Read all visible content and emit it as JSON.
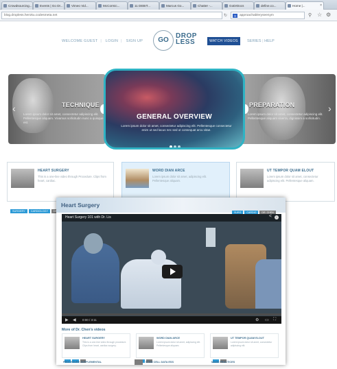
{
  "browser": {
    "tabs": [
      {
        "label": "Crowdsourcing..."
      },
      {
        "label": "Events | Go Dr..."
      },
      {
        "label": "Vimeo Vid..."
      },
      {
        "label": "McCormic..."
      },
      {
        "label": "11 DEBIT..."
      },
      {
        "label": "Marcus Go..."
      },
      {
        "label": "Chatter -..."
      },
      {
        "label": "GoDrDocs"
      },
      {
        "label": "define.co..."
      },
      {
        "label": "Home |..."
      }
    ],
    "url": "blog.dropless.heroku.codesmeta.net",
    "search": "approachableryseenym"
  },
  "header": {
    "nav_left": [
      "WELCOME GUEST",
      "LOGIN",
      "SIGN UP"
    ],
    "logo_go": "GO",
    "logo_drop": "DROP",
    "logo_less": "LESS",
    "watch_videos": "WATCH VIDEOS",
    "nav_right": [
      "SERIES",
      "HELP"
    ]
  },
  "carousel": {
    "left": {
      "title": "TECHNIQUE",
      "text": "Lorem ipsum dolor sit amet, consectetur adipiscing elit. Pellentesque aliquam. Vivamus sollicitudin nunc a quisque est."
    },
    "center": {
      "title": "GENERAL OVERVIEW",
      "text": "Lorem ipsum dolor sit amet, consectetur adipiscing elit. Pellentesque consectetur enim ut sed lacus nec sed ut consequat arcu vitae."
    },
    "right": {
      "title": "PREPARATION",
      "text": "Lorem ipsum dolor sit amet, consectetur adipiscing elit. Pellentesque aliquam viverra, dignissim a sollicitudin."
    },
    "prev_arrow": "‹",
    "next_arrow": "›"
  },
  "cards": [
    {
      "title": "HEART SURGERY",
      "desc": "This is a one-line video through Procedure. Clips from heart, cardiac.",
      "tags": [
        "SURGERY",
        "CARDIOLOGY",
        "DR. ..."
      ]
    },
    {
      "title": "WORD DIAN ARCE",
      "desc": "Lorem ipsum dolor sit amet, adipiscing elit. Pellentesque aliquam.",
      "tags": []
    },
    {
      "title": "UT TEMPOR QUAM ELOUT",
      "desc": "Lorem ipsum dolor sit amet, consectetur adipiscing elit. Pellentesque aliquam.",
      "tags": []
    }
  ],
  "modal": {
    "title": "Heart Surgery",
    "tags": [
      "SURG",
      "CARDIO",
      "DR. CHEN"
    ],
    "video_title": "Heart Surgery 101 with Dr. Lis",
    "share": "<",
    "info": "i",
    "time": "0:00 / 3:11",
    "more_title": "More of Dr. Chen's videos",
    "more_cards": [
      {
        "title": "HEART SURGERY",
        "desc": "This is a one-line video through procedure. Clips from heart, cardiac surgery."
      },
      {
        "title": "WORD DIAN ARCE",
        "desc": "Lorem ipsum dolor sit amet, adipiscing elit. Pellentesque aliquam."
      },
      {
        "title": "UT TEMPOR QUAM ELOUT",
        "desc": "Lorem ipsum dolor sit amet, consectetur adipiscing elit."
      }
    ],
    "bottom_items": [
      "PROCEDURE SUPPLEMENTAL",
      "STEM CELL DATA ESS",
      "MADE PRACTICES"
    ]
  }
}
